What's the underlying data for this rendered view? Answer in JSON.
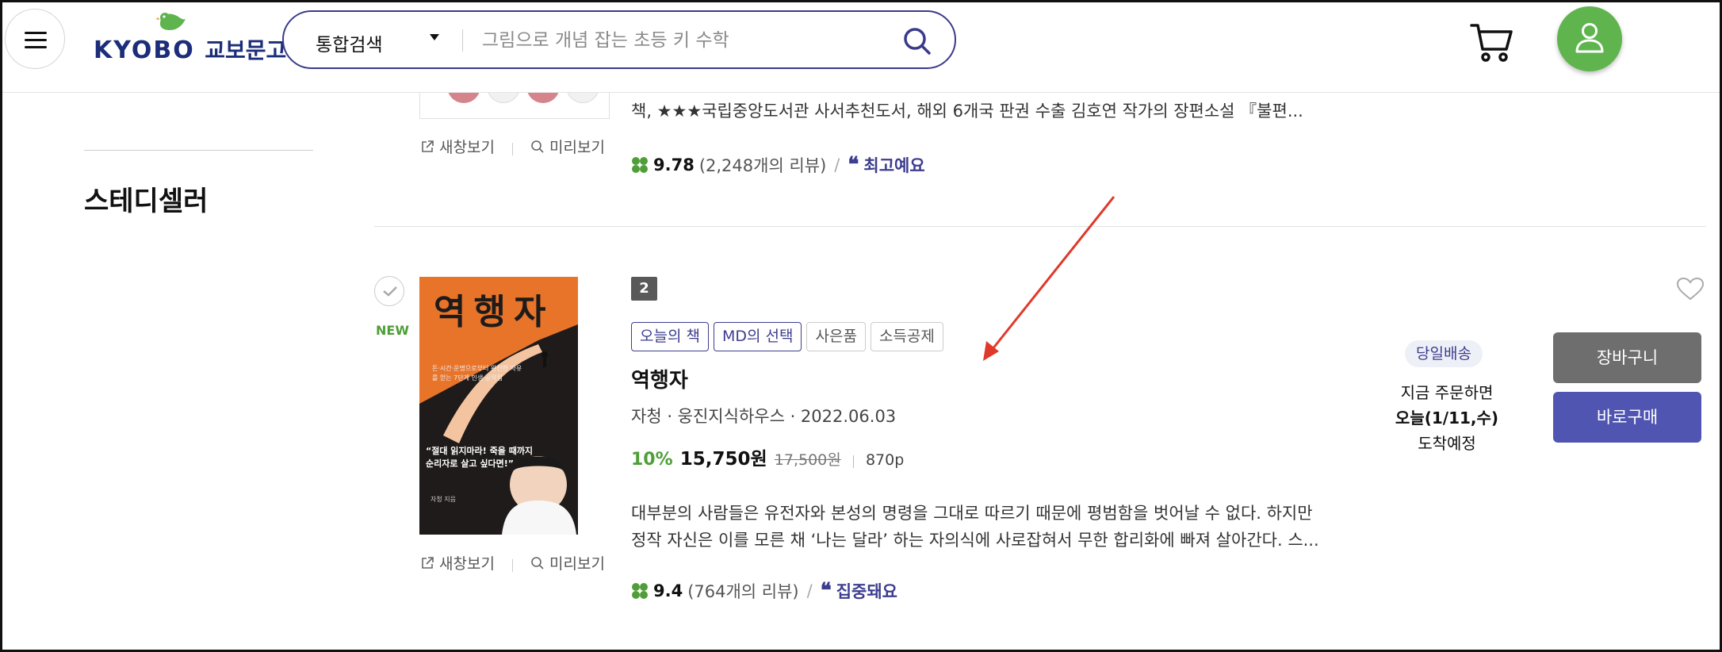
{
  "header": {
    "logo_text": "KYOBO",
    "logo_korean": "교보문고",
    "search_category": "통합검색",
    "search_placeholder": "그림으로 개념 잡는 초등 키 수학"
  },
  "sidebar": {
    "section_title": "스테디셀러"
  },
  "previous_item": {
    "description": "책, ★★★국립중앙도서관 사서추천도서, 해외 6개국 판권 수출 김호연 작가의 장편소설 『불편...",
    "new_window_label": "새창보기",
    "preview_label": "미리보기",
    "score": "9.78",
    "reviews": "(2,248개의 리뷰)",
    "keyword": "최고예요"
  },
  "item": {
    "badge_new": "NEW",
    "rank": "2",
    "tags": [
      "오늘의 책",
      "MD의 선택",
      "사은품",
      "소득공제"
    ],
    "title": "역행자",
    "meta": "자청 · 웅진지식하우스 · 2022.06.03",
    "discount": "10%",
    "sale_price": "15,750원",
    "original_price": "17,500원",
    "pages": "870p",
    "description_line1": "대부분의 사람들은 유전자와 본성의 명령을 그대로 따르기 때문에 평범함을 벗어날 수 없다. 하지만",
    "description_line2": "정작 자신은 이를 모른 채 ‘나는 달라’ 하는 자의식에 사로잡혀서 무한 합리화에 빠져 살아간다. 스...",
    "new_window_label": "새창보기",
    "preview_label": "미리보기",
    "score": "9.4",
    "reviews": "(764개의 리뷰)",
    "keyword": "집중돼요",
    "same_day_badge": "당일배송",
    "delivery_line1": "지금 주문하면",
    "delivery_line2": "오늘(1/11,수)",
    "delivery_line3": "도착예정",
    "cart_button": "장바구니",
    "buy_button": "바로구매"
  },
  "cover": {
    "title": "역행자",
    "subtitle": "돈·시간·운명으로부터 완전한 자유를 얻는 7단계 인생 공략집",
    "quote_line1": "“절대 읽지마라! 죽을 때까지",
    "quote_line2": "순리자로 살고 싶다면!”",
    "author": "자청 지음"
  },
  "colors": {
    "brand_navy": "#3d3d8f",
    "green": "#4f9e38",
    "buy_button": "#4f55b0",
    "cart_button": "#6e6e6e",
    "cover_orange": "#e8742a",
    "annotation_arrow": "#e0392b"
  }
}
